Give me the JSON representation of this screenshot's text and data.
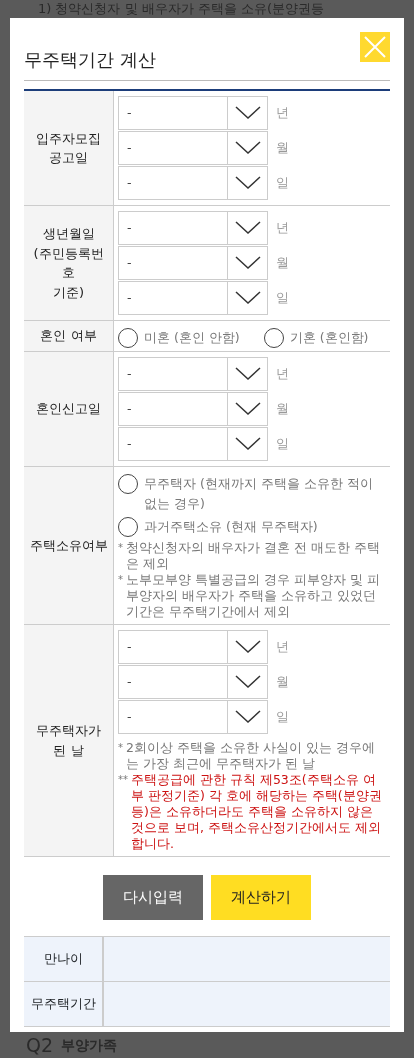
{
  "background": {
    "top_lines": [
      "1) 청약신청자 및 배우자가 주택을 소유(분양권등"
    ],
    "question_number": "Q2",
    "question_title": "부양가족"
  },
  "modal": {
    "title": "무주택기간 계산",
    "rows": [
      {
        "label": "입주자모집 공고일",
        "selects": [
          {
            "value": "-",
            "unit": "년"
          },
          {
            "value": "-",
            "unit": "월"
          },
          {
            "value": "-",
            "unit": "일"
          }
        ]
      },
      {
        "label": "생년월일\n(주민등록번호\n기준)",
        "selects": [
          {
            "value": "-",
            "unit": "년"
          },
          {
            "value": "-",
            "unit": "월"
          },
          {
            "value": "-",
            "unit": "일"
          }
        ]
      },
      {
        "label": "혼인 여부",
        "inline": true,
        "options": [
          {
            "label": "미혼 (혼인 안함)",
            "selected": false
          },
          {
            "label": "기혼 (혼인함)",
            "selected": false
          }
        ]
      },
      {
        "label": "혼인신고일",
        "selects": [
          {
            "value": "-",
            "unit": "년"
          },
          {
            "value": "-",
            "unit": "월"
          },
          {
            "value": "-",
            "unit": "일"
          }
        ]
      },
      {
        "label": "주택소유여부",
        "options": [
          {
            "label": "무주택자 (현재까지 주택을 소유한 적이 없는 경우)",
            "selected": false
          },
          {
            "label": "과거주택소유 (현재 무주택자)",
            "selected": false
          }
        ],
        "notes": [
          {
            "mark": "*",
            "text": "청약신청자의 배우자가 결혼 전 매도한 주택은 제외",
            "color": "#777777"
          },
          {
            "mark": "*",
            "text": "노부모부양 특별공급의 경우 피부양자 및 피부양자의 배우자가 주택을 소유하고 있었던 기간은 무주택기간에서 제외",
            "color": "#777777"
          }
        ]
      },
      {
        "label": "무주택자가 된 날",
        "selects": [
          {
            "value": "-",
            "unit": "년"
          },
          {
            "value": "-",
            "unit": "월"
          },
          {
            "value": "-",
            "unit": "일"
          }
        ],
        "notes": [
          {
            "mark": "*",
            "text": "2회이상 주택을 소유한 사실이 있는 경우에는 가장 최근에 무주택자가 된 날",
            "color": "#777777"
          },
          {
            "mark": "**",
            "text": "주택공급에 관한 규칙 제53조(주택소유 여부 판정기준) 각 호에 해당하는 주택(분양권 등)은 소유하더라도 주택을 소유하지 않은 것으로 보며, 주택소유산정기간에서도 제외 합니다.",
            "color": "#cc1111"
          }
        ]
      }
    ],
    "buttons": [
      {
        "label": "다시입력",
        "kind": "reset"
      },
      {
        "label": "계산하기",
        "kind": "submit"
      }
    ],
    "results": [
      {
        "label": "만나이"
      },
      {
        "label": "무주택기간"
      }
    ]
  }
}
